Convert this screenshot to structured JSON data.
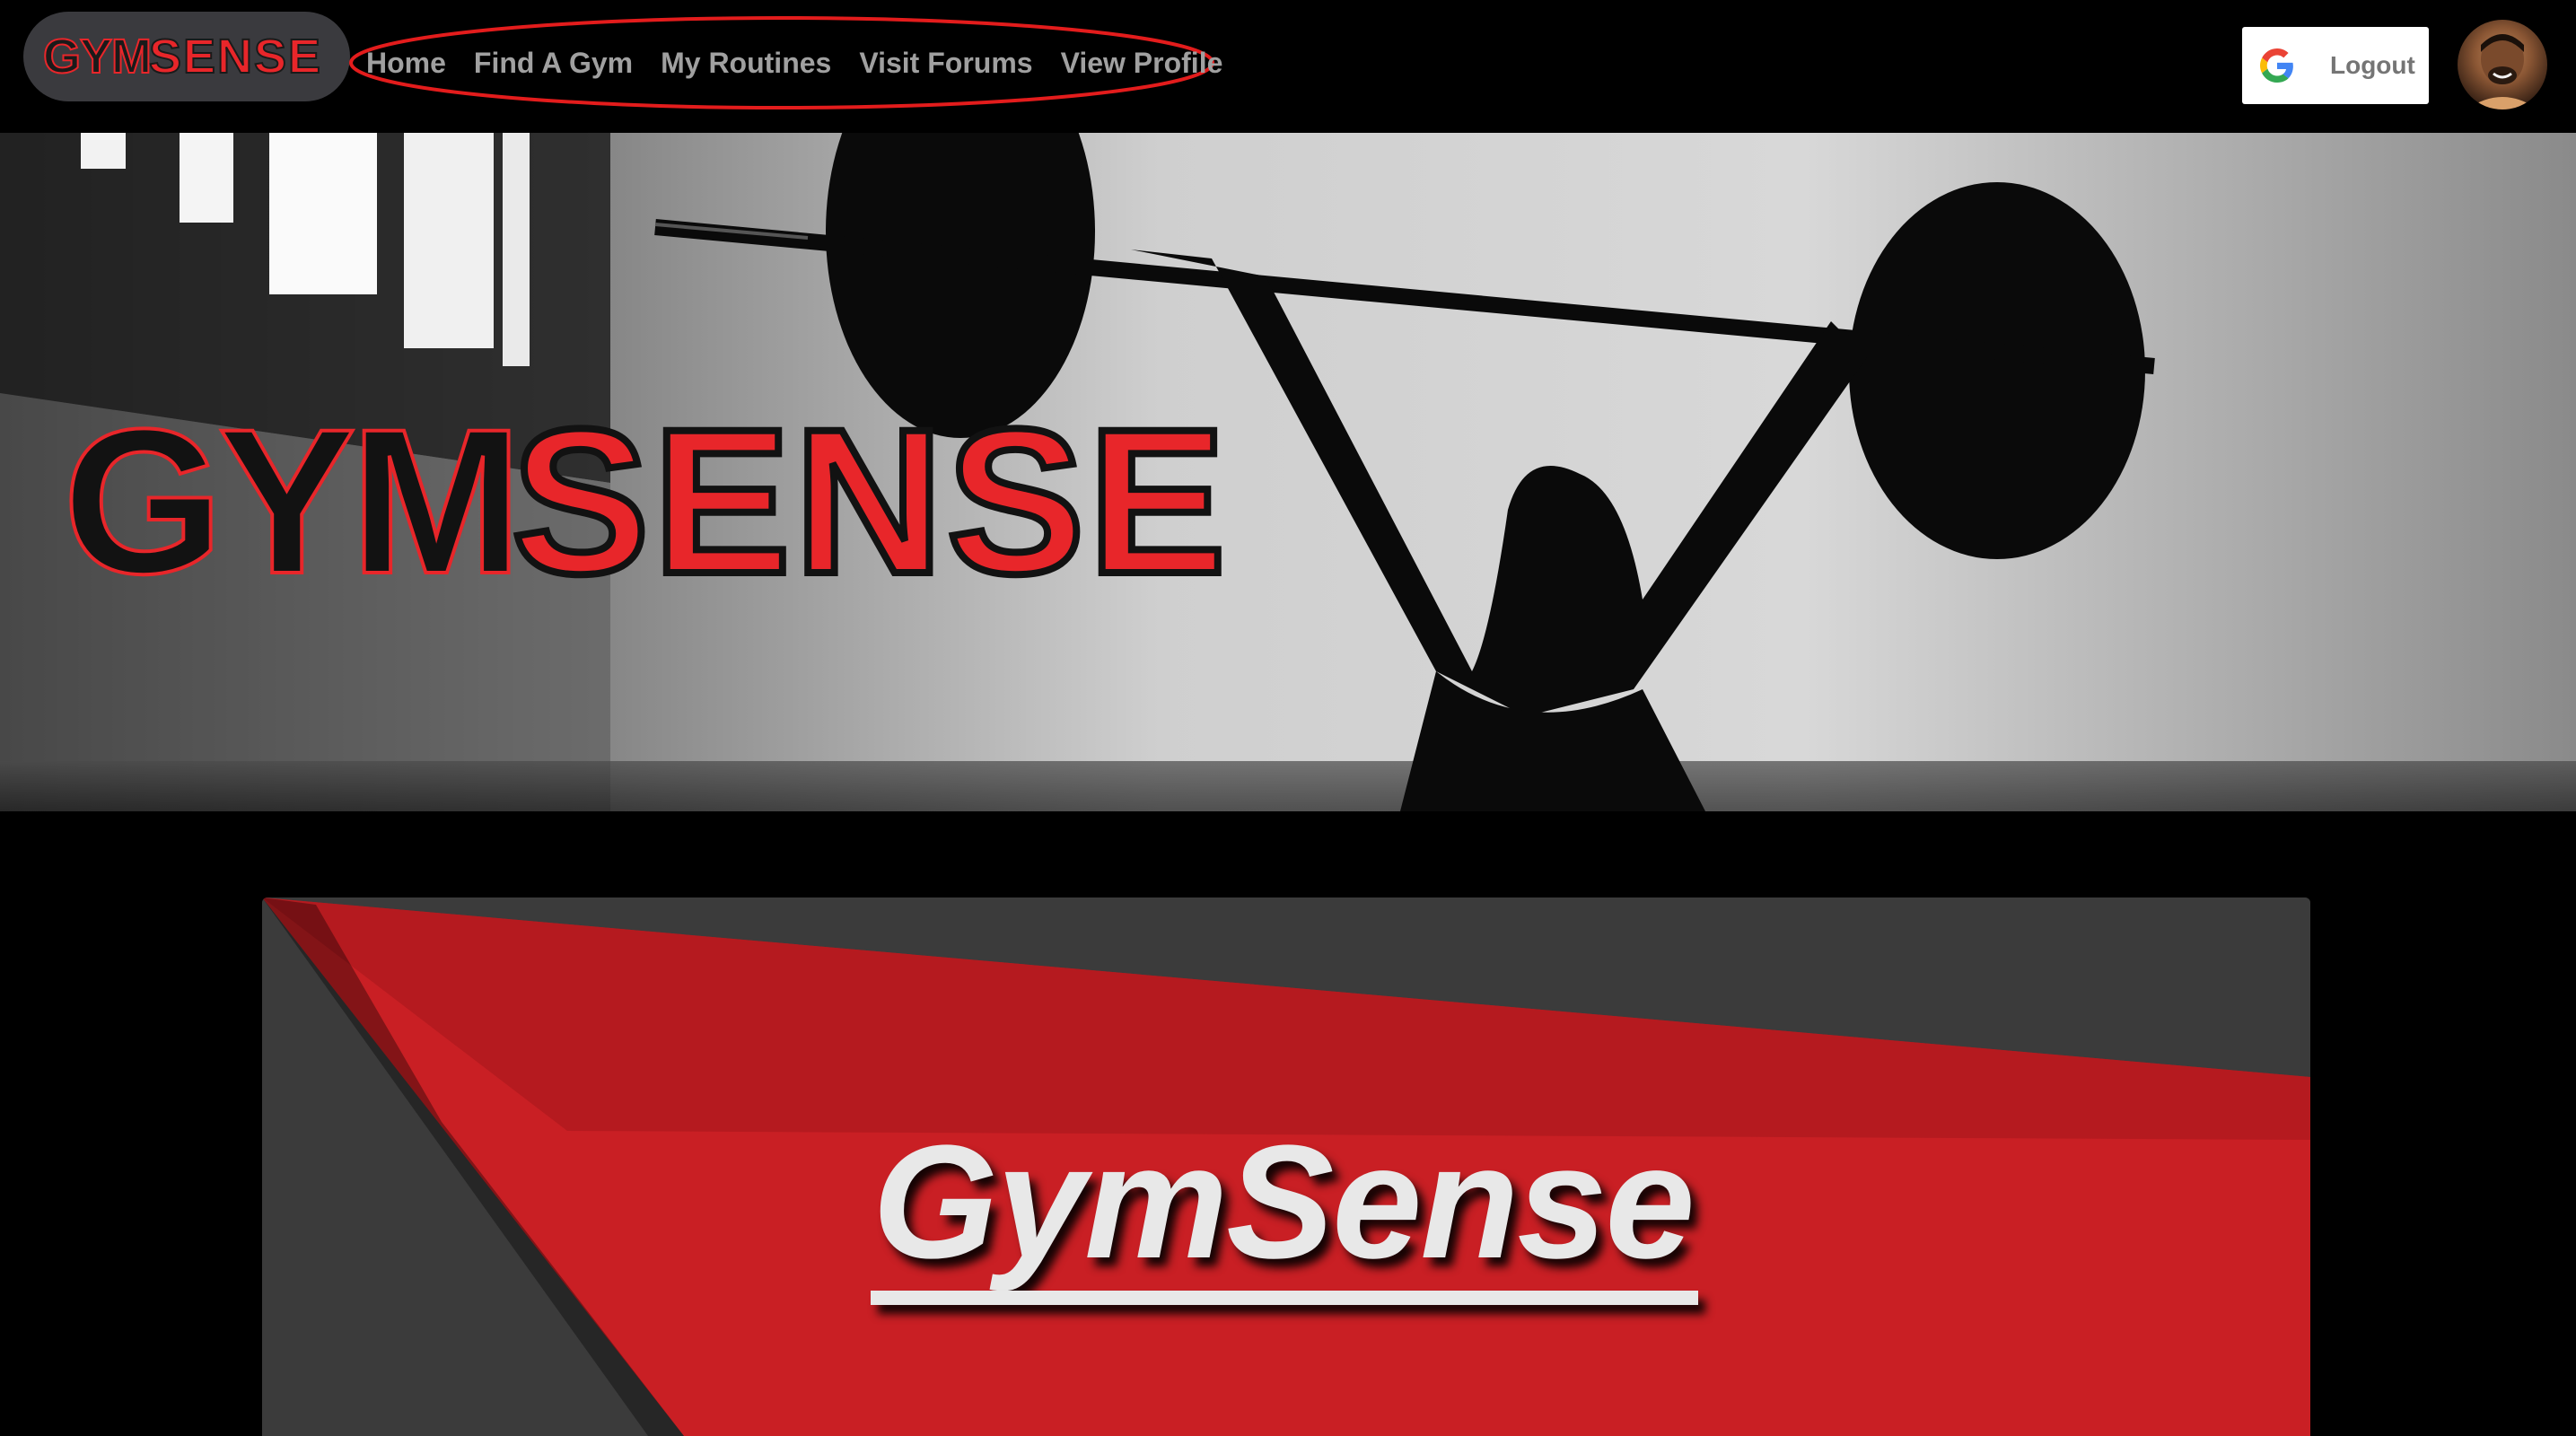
{
  "brand": {
    "logo_left": "GYM",
    "logo_right": "SENSE",
    "colors": {
      "red": "#e8262a",
      "dark": "#1a1a1a",
      "pill": "#3a3a3e"
    }
  },
  "nav": {
    "links": [
      {
        "label": "Home"
      },
      {
        "label": "Find A Gym"
      },
      {
        "label": "My Routines"
      },
      {
        "label": "Visit Forums"
      },
      {
        "label": "View Profile"
      }
    ]
  },
  "auth": {
    "logout_label": "Logout",
    "provider_icon": "google-icon"
  },
  "user": {
    "avatar_icon": "user-avatar"
  },
  "card": {
    "title": "GymSense",
    "colors": {
      "red": "#c91f24",
      "gray": "#3a3a3a"
    }
  }
}
